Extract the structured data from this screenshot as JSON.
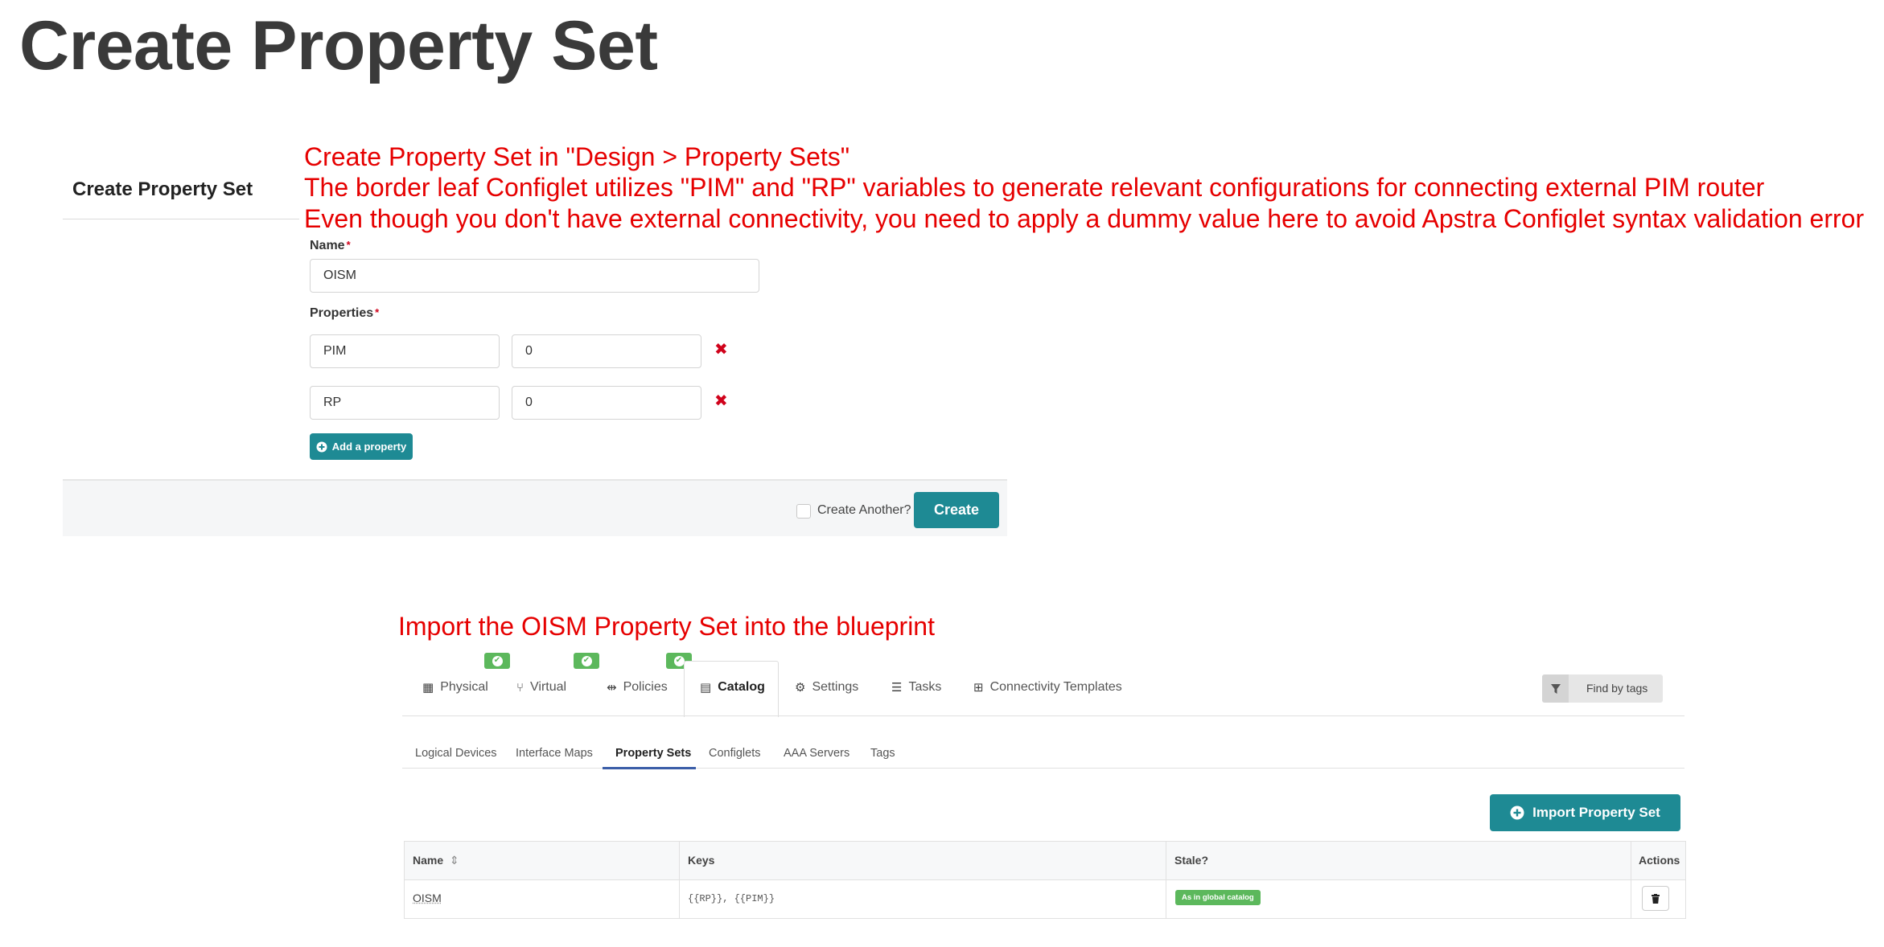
{
  "slide": {
    "title": "Create Property Set"
  },
  "annotations": {
    "line1": "Create Property Set in \"Design > Property Sets\"",
    "line2": "The border leaf Configlet utilizes \"PIM\" and \"RP\" variables to generate relevant configurations for connecting external PIM router",
    "line3": "Even though you don't have external connectivity, you need to apply a dummy value here to avoid Apstra Configlet syntax validation error",
    "import_note": "Import the OISM Property Set into the blueprint"
  },
  "form": {
    "heading": "Create Property Set",
    "name_label": "Name",
    "name_value": "OISM",
    "required_mark": "*",
    "properties_label": "Properties",
    "properties": [
      {
        "key": "PIM",
        "value": "0"
      },
      {
        "key": "RP",
        "value": "0"
      }
    ],
    "remove_glyph": "✖",
    "add_property_label": "Add a property",
    "create_another_label": "Create Another?",
    "create_label": "Create"
  },
  "blueprint": {
    "tabs": [
      {
        "label": "Physical",
        "icon": "building-icon",
        "glyph": "▦",
        "badge": true
      },
      {
        "label": "Virtual",
        "icon": "branch-icon",
        "glyph": "⑂",
        "badge": true
      },
      {
        "label": "Policies",
        "icon": "signpost-icon",
        "glyph": "⇹",
        "badge": true
      },
      {
        "label": "Catalog",
        "icon": "list-alt-icon",
        "glyph": "▤",
        "badge": false,
        "active": true
      },
      {
        "label": "Settings",
        "icon": "gears-icon",
        "glyph": "⚙",
        "badge": false
      },
      {
        "label": "Tasks",
        "icon": "tasks-icon",
        "glyph": "☰",
        "badge": false
      },
      {
        "label": "Connectivity Templates",
        "icon": "sitemap-icon",
        "glyph": "⊞",
        "badge": false
      }
    ],
    "badge_check": "✔",
    "find_by_tags": "Find by tags",
    "subtabs": [
      "Logical Devices",
      "Interface Maps",
      "Property Sets",
      "Configlets",
      "AAA Servers",
      "Tags"
    ],
    "active_subtab": "Property Sets",
    "import_button": "Import Property Set",
    "table": {
      "headers": [
        "Name",
        "Keys",
        "Stale?",
        "Actions"
      ],
      "sort_glyph": "⇕",
      "rows": [
        {
          "name": "OISM",
          "keys": "{{RP}}, {{PIM}}",
          "stale": "As in global catalog"
        }
      ]
    }
  },
  "colors": {
    "annotation_red": "#e60000",
    "teal_button": "#1e8a94",
    "success_green": "#5cb85c",
    "required_red": "#d0021b"
  }
}
